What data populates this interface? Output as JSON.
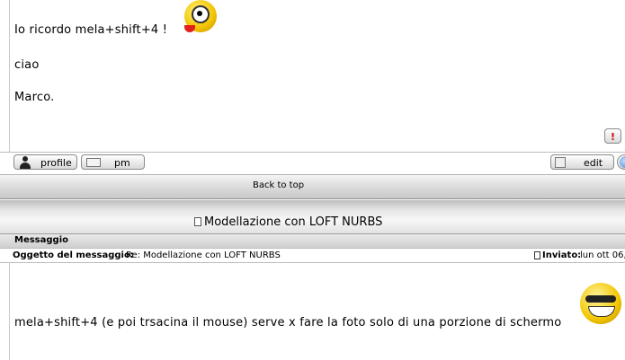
{
  "post1": {
    "lines": [
      "Io ricordo mela+shift+4 !",
      "ciao",
      "Marco."
    ],
    "report_icon": "!",
    "buttons": {
      "profile": "profile",
      "pm": "pm",
      "edit": "edit"
    }
  },
  "back_to_top": "Back to top",
  "topic": {
    "title": "Modellazione con LOFT NURBS",
    "icon": "document-icon"
  },
  "table_header": {
    "message_col": "Messaggio"
  },
  "post2": {
    "subject_label": "Oggetto del messaggio:",
    "subject_value": "Re: Modellazione con LOFT NURBS",
    "sent_label": "Inviato:",
    "sent_value": "lun ott 06,",
    "body": "mela+shift+4 (e poi trsacina il mouse) serve x fare la foto solo di una porzione di schermo"
  }
}
